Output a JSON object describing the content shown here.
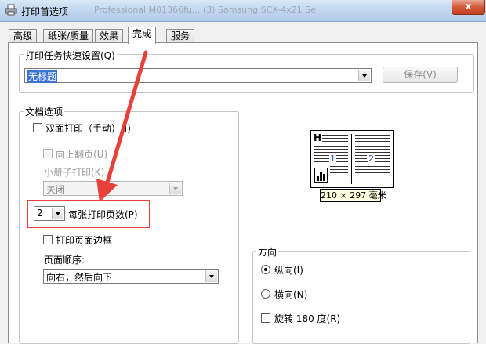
{
  "window": {
    "title": "打印首选项",
    "title_ghost": "Professional M01366fu... (3) Samsung SCX-4x21 Se",
    "close_label": "x"
  },
  "tabs": [
    {
      "label": "高级"
    },
    {
      "label": "纸张/质量"
    },
    {
      "label": "效果"
    },
    {
      "label": "完成",
      "active": true
    },
    {
      "label": "服务"
    }
  ],
  "quick_settings": {
    "legend": "打印任务快速设置(Q)",
    "value": "无标题",
    "save_label": "保存(V)"
  },
  "doc_options": {
    "legend": "文档选项",
    "duplex_label": "双面打印（手动）(I)",
    "flip_up_label": "向上翻页(U)",
    "booklet_label": "小册子打印(K)",
    "booklet_value": "关闭",
    "pages_per_sheet_value": "2",
    "pages_per_sheet_label": "每张打印页数(P)",
    "page_borders_label": "打印页面边框",
    "page_order_label": "页面顺序:",
    "page_order_value": "向右，然后向下"
  },
  "preview": {
    "header_letter": "H",
    "page_numbers": [
      "1",
      "2"
    ],
    "size_label": "210 × 297 毫米"
  },
  "orientation": {
    "legend": "方向",
    "portrait_label": "纵向(I)",
    "landscape_label": "横向(N)",
    "rotate_label": "旋转 180 度(R)",
    "selected": "portrait"
  },
  "annotation": {
    "color": "#e8413b"
  }
}
